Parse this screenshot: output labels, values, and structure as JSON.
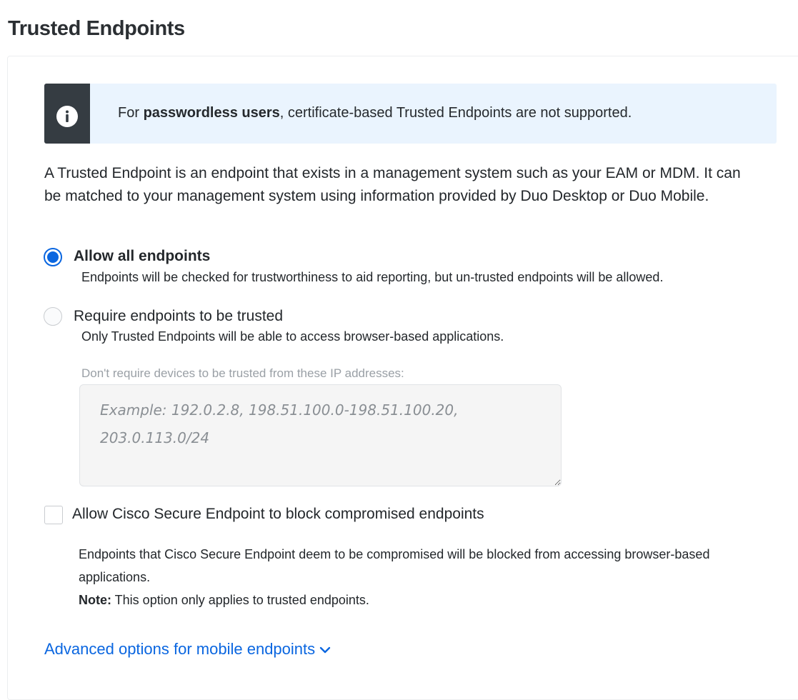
{
  "page": {
    "title": "Trusted Endpoints"
  },
  "banner": {
    "icon": "info-icon",
    "text_prefix": "For ",
    "text_bold": "passwordless users",
    "text_suffix": ", certificate-based Trusted Endpoints are not supported."
  },
  "description": "A Trusted Endpoint is an endpoint that exists in a management system such as your EAM or MDM. It can be matched to your management system using information provided by Duo Desktop or Duo Mobile.",
  "options": {
    "allow_all": {
      "label": "Allow all endpoints",
      "help": "Endpoints will be checked for trustworthiness to aid reporting, but un-trusted endpoints will be allowed.",
      "selected": true
    },
    "require_trusted": {
      "label": "Require endpoints to be trusted",
      "help": "Only Trusted Endpoints will be able to access browser-based applications.",
      "selected": false
    }
  },
  "ip_exceptions": {
    "label": "Don't require devices to be trusted from these IP addresses:",
    "value": "",
    "placeholder": "Example: 192.0.2.8, 198.51.100.0-198.51.100.20, 203.0.113.0/24"
  },
  "cisco_secure": {
    "label": "Allow Cisco Secure Endpoint to block compromised endpoints",
    "checked": false,
    "help": "Endpoints that Cisco Secure Endpoint deem to be compromised will be blocked from accessing browser-based applications.",
    "note_label": "Note:",
    "note_text": " This option only applies to trusted endpoints."
  },
  "advanced": {
    "label": "Advanced options for mobile endpoints",
    "icon": "chevron-down-icon"
  },
  "colors": {
    "accent": "#0a66e0",
    "banner_bg": "#eaf4fe",
    "banner_icon_bg": "#353c42",
    "muted_text": "#9aa0a6"
  }
}
